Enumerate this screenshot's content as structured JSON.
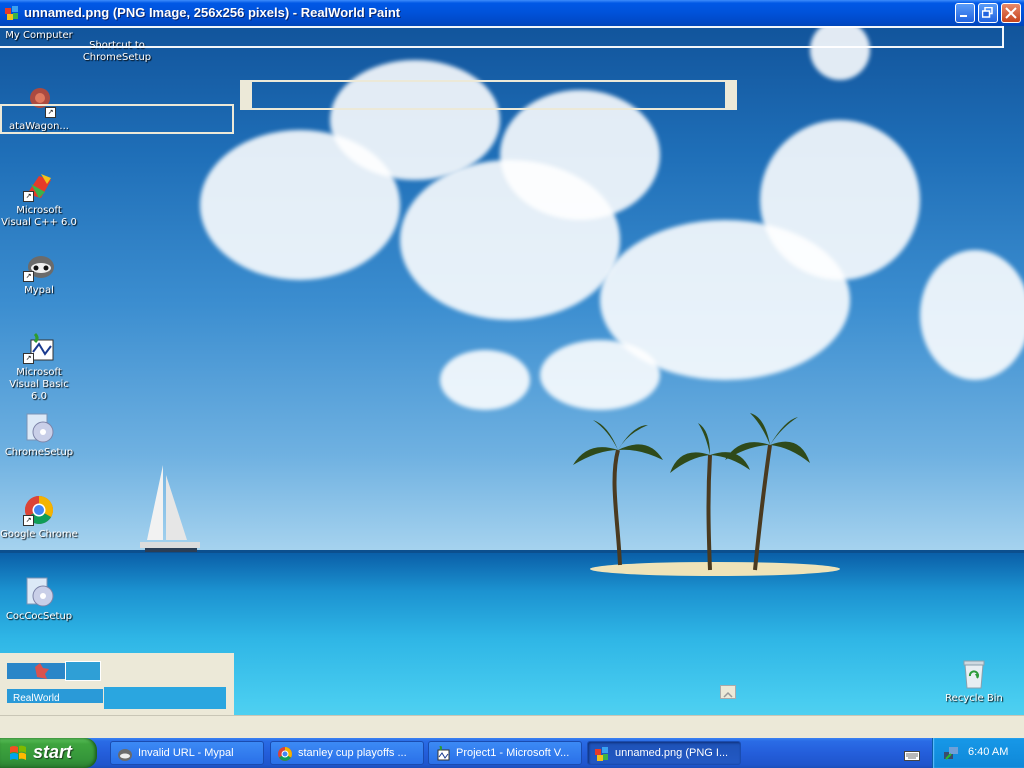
{
  "window": {
    "title": "unnamed.png (PNG Image, 256x256 pixels) - RealWorld Paint",
    "colors": {
      "titlebar": "#0054e3",
      "frame": "#ece9d8"
    }
  },
  "desktop": {
    "icons": [
      {
        "id": "my-computer",
        "label": "My Computer"
      },
      {
        "id": "shortcut-chromesetup",
        "label": "Shortcut to ChromeSetup"
      },
      {
        "id": "datawagon",
        "label": "ataWagon..."
      },
      {
        "id": "visual-cpp",
        "label": "Microsoft Visual C++ 6.0"
      },
      {
        "id": "mypal",
        "label": "Mypal"
      },
      {
        "id": "visual-basic",
        "label": "Microsoft Visual Basic 6.0"
      },
      {
        "id": "chromesetup",
        "label": "ChromeSetup"
      },
      {
        "id": "google-chrome",
        "label": "Google Chrome"
      },
      {
        "id": "coccocsetup",
        "label": "CocCocSetup"
      },
      {
        "id": "recycle-bin",
        "label": "Recycle Bin"
      }
    ]
  },
  "bottom_panel": {
    "realworld_label": "RealWorld"
  },
  "taskbar": {
    "start_label": "start",
    "tasks": [
      {
        "label": "Invalid URL - Mypal",
        "icon": "mypal-icon"
      },
      {
        "label": "stanley cup playoffs ...",
        "icon": "chrome-icon"
      },
      {
        "label": "Project1 - Microsoft V...",
        "icon": "vb-icon"
      },
      {
        "label": "unnamed.png (PNG I...",
        "icon": "realworld-paint-icon",
        "active": true
      }
    ],
    "tray": {
      "clock": "6:40 AM"
    },
    "colors": {
      "start": "#3ea43e",
      "bar": "#245edb",
      "tray": "#0f88d8"
    }
  }
}
